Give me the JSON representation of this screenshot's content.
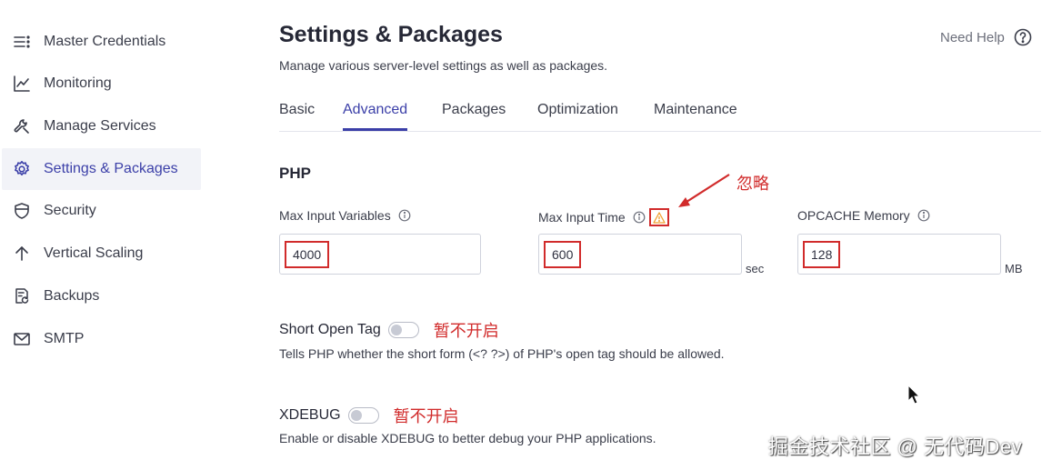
{
  "sidebar": {
    "items": [
      {
        "label": "Master Credentials",
        "icon": "list-icon",
        "active": false
      },
      {
        "label": "Monitoring",
        "icon": "chart-line-icon",
        "active": false
      },
      {
        "label": "Manage Services",
        "icon": "wrench-icon",
        "active": false
      },
      {
        "label": "Settings & Packages",
        "icon": "gear-icon",
        "active": true
      },
      {
        "label": "Security",
        "icon": "shield-icon",
        "active": false
      },
      {
        "label": "Vertical Scaling",
        "icon": "arrow-up-icon",
        "active": false
      },
      {
        "label": "Backups",
        "icon": "backup-icon",
        "active": false
      },
      {
        "label": "SMTP",
        "icon": "mail-icon",
        "active": false
      }
    ]
  },
  "header": {
    "title": "Settings & Packages",
    "subtitle": "Manage various server-level settings as well as packages.",
    "help_label": "Need Help"
  },
  "tabs": [
    {
      "label": "Basic",
      "active": false
    },
    {
      "label": "Advanced",
      "active": true
    },
    {
      "label": "Packages",
      "active": false
    },
    {
      "label": "Optimization",
      "active": false
    },
    {
      "label": "Maintenance",
      "active": false
    }
  ],
  "php": {
    "section_title": "PHP",
    "fields": [
      {
        "label": "Max Input Variables",
        "value": "4000",
        "unit": ""
      },
      {
        "label": "Max Input Time",
        "value": "600",
        "unit": "sec"
      },
      {
        "label": "OPCACHE Memory",
        "value": "128",
        "unit": "MB"
      }
    ],
    "warning_annotation": "忽略",
    "short_open_tag": {
      "label": "Short Open Tag",
      "enabled": false,
      "annotation": "暂不开启",
      "description": "Tells PHP whether the short form (<? ?>) of PHP's open tag should be allowed."
    },
    "xdebug": {
      "label": "XDEBUG",
      "enabled": false,
      "annotation": "暂不开启",
      "description": "Enable or disable XDEBUG to better debug your PHP applications."
    }
  },
  "watermark": "掘金技术社区 @ 无代码Dev",
  "colors": {
    "accent": "#3b3fa8",
    "annotation_red": "#d12b2b",
    "active_bg": "#f2f3f8",
    "warning_orange": "#f0a030"
  }
}
